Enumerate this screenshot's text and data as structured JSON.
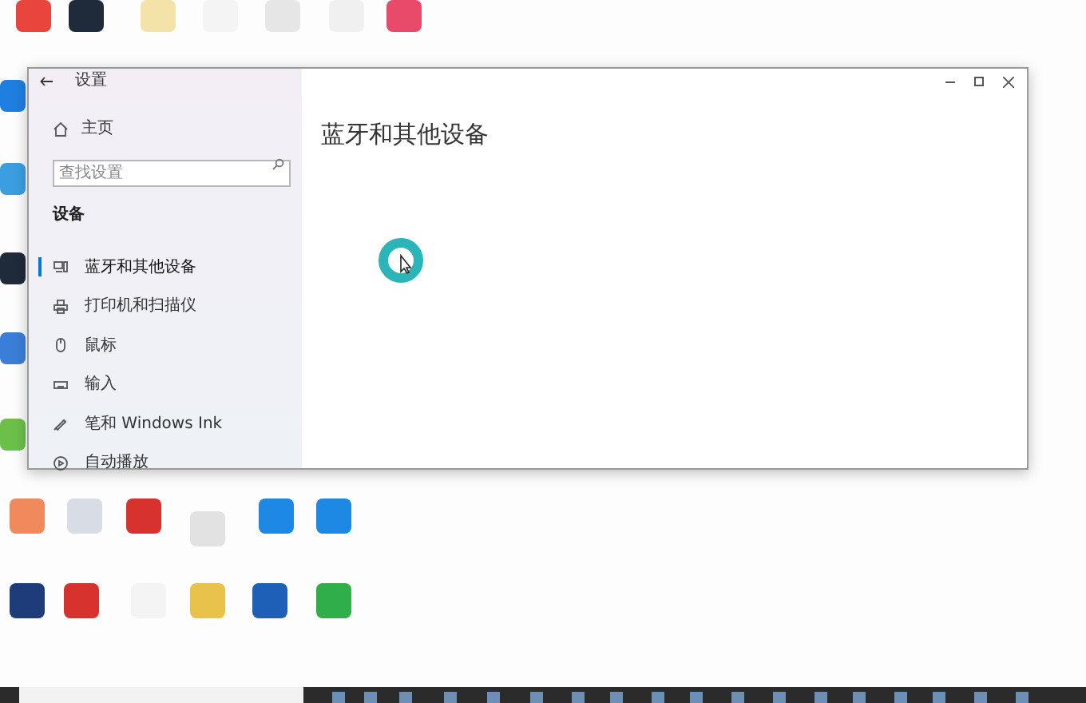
{
  "window": {
    "title": "设置",
    "heading": "蓝牙和其他设备"
  },
  "sidebar": {
    "home": "主页",
    "search": {
      "placeholder": "查找设置"
    },
    "section": "设备",
    "items": [
      {
        "kind": "bluetooth",
        "label": "蓝牙和其他设备",
        "selected": true
      },
      {
        "kind": "printer",
        "label": "打印机和扫描仪",
        "selected": false
      },
      {
        "kind": "mouse",
        "label": "鼠标",
        "selected": false
      },
      {
        "kind": "keyboard",
        "label": "输入",
        "selected": false
      },
      {
        "kind": "pen",
        "label": "笔和 Windows Ink",
        "selected": false
      },
      {
        "kind": "autoplay",
        "label": "自动播放",
        "selected": false
      }
    ]
  }
}
